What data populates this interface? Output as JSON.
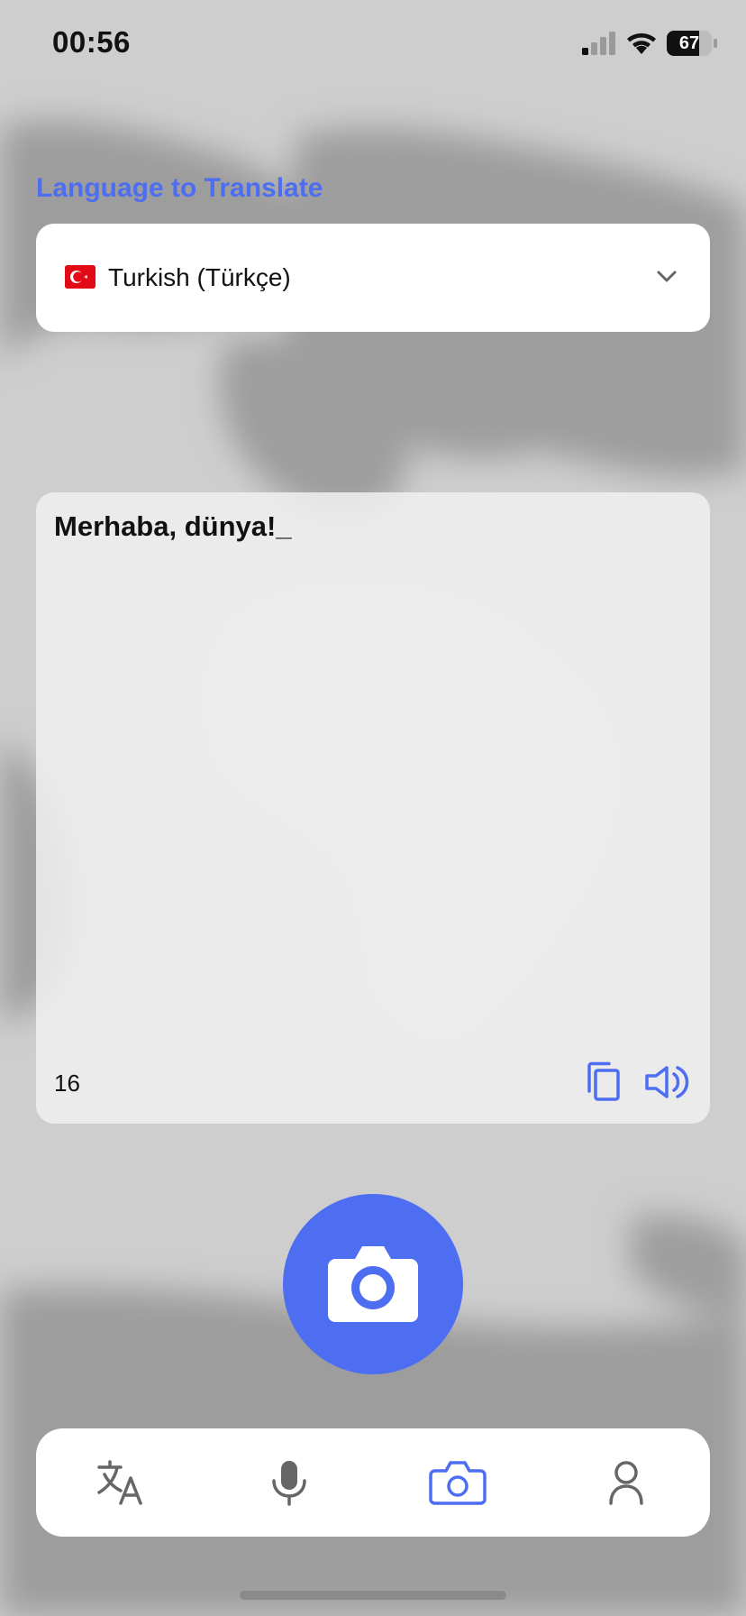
{
  "status_bar": {
    "time": "00:56",
    "battery_level": "67",
    "signal_icon": "cellular-signal-icon",
    "wifi_icon": "wifi-icon",
    "battery_icon": "battery-icon"
  },
  "language_picker": {
    "label": "Language to Translate",
    "selected_language": "Turkish (Türkçe)",
    "flag_icon": "turkey-flag-icon",
    "chevron_icon": "chevron-down-icon"
  },
  "translation": {
    "text": "Merhaba, dünya!_",
    "char_count": "16",
    "copy_icon": "copy-icon",
    "speaker_icon": "speaker-icon"
  },
  "capture": {
    "icon": "camera-icon"
  },
  "tab_bar": {
    "tabs": [
      {
        "icon": "translate-icon",
        "active": false
      },
      {
        "icon": "microphone-icon",
        "active": false
      },
      {
        "icon": "camera-icon",
        "active": true
      },
      {
        "icon": "profile-icon",
        "active": false
      }
    ]
  },
  "colors": {
    "accent": "#4e6ef2",
    "inactive_icon": "#666666",
    "card_background": "#ffffff",
    "screen_background": "#cfcfcf"
  }
}
